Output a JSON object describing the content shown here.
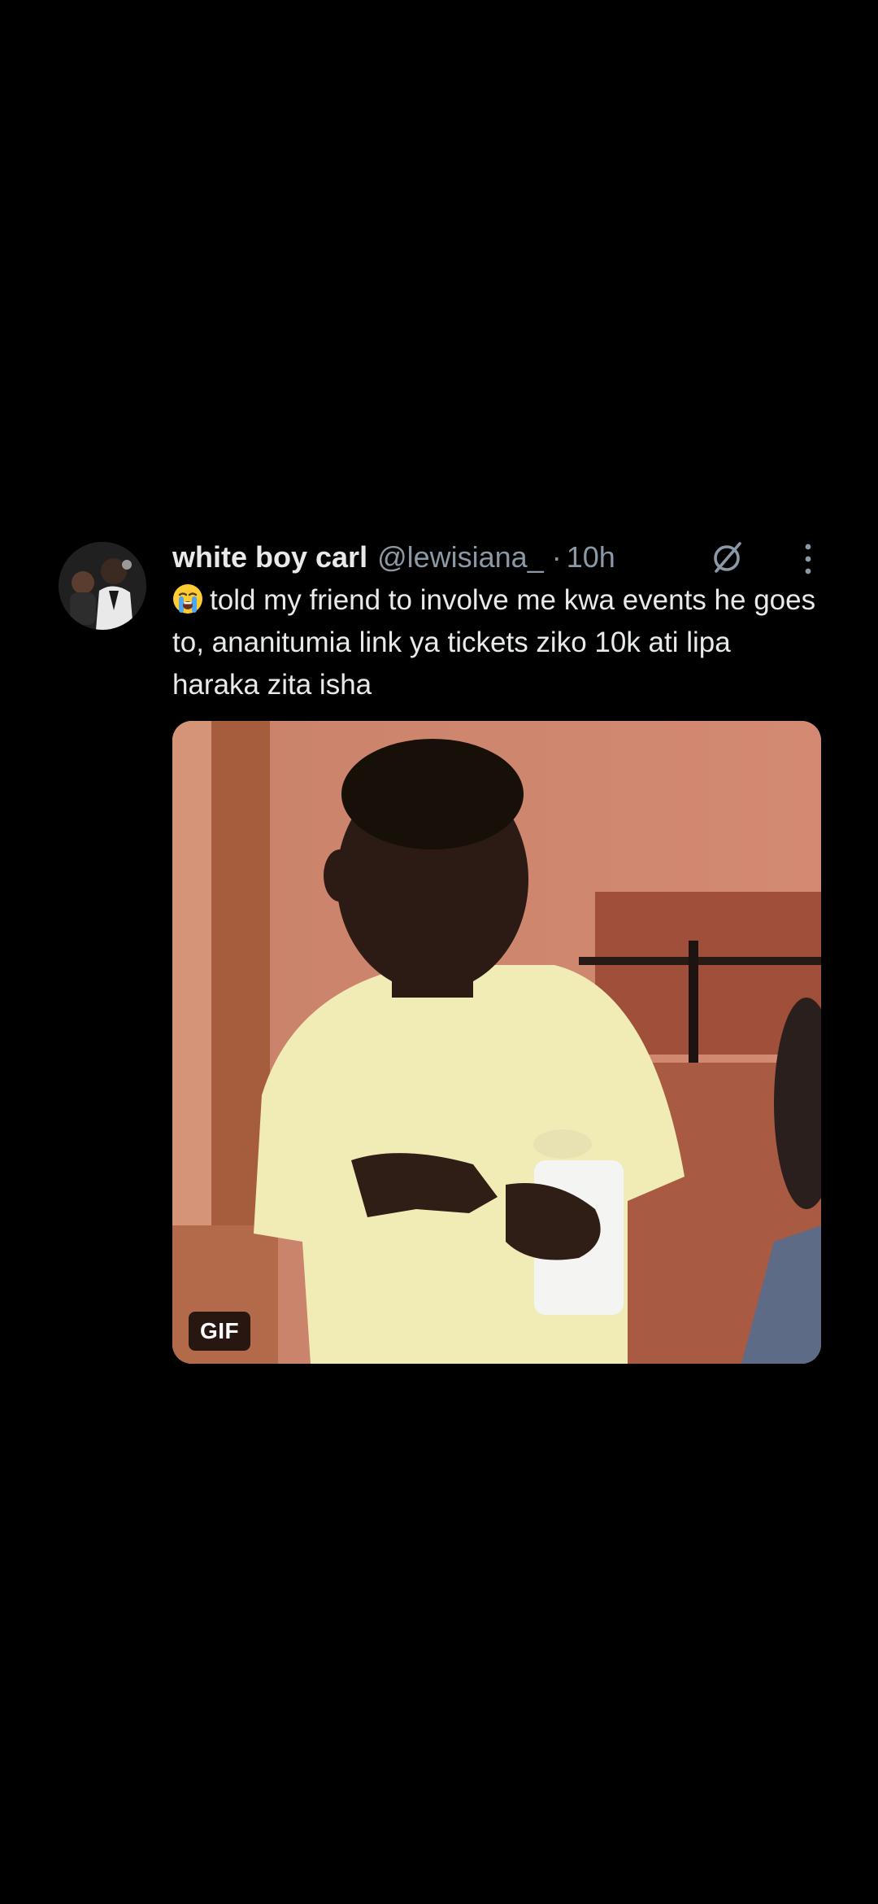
{
  "tweet": {
    "display_name": "white boy carl",
    "handle": "@lewisiana_",
    "separator": "·",
    "time": "10h",
    "emoji": "loudly-crying-face",
    "text": "told my friend to involve me kwa events he goes to, ananitumia link ya tickets ziko 10k ati lipa haraka zita isha",
    "media": {
      "type": "gif",
      "badge": "GIF"
    },
    "icons": {
      "avatar": "profile-photo",
      "grok": "grok-icon",
      "more": "more-vertical-icon"
    }
  },
  "colors": {
    "background": "#000000",
    "primary_text": "#e7e9ea",
    "secondary_text": "#8b98a5"
  }
}
